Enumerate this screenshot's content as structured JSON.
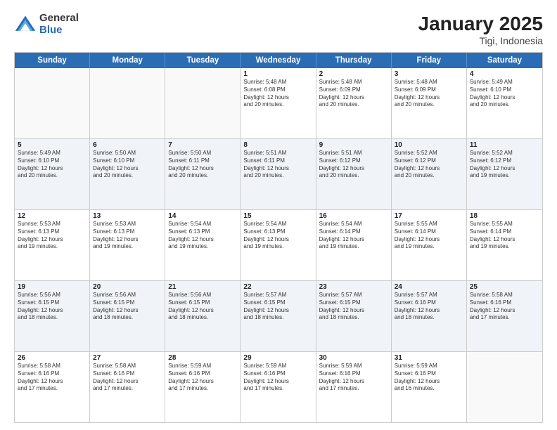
{
  "logo": {
    "general": "General",
    "blue": "Blue"
  },
  "title": {
    "month": "January 2025",
    "location": "Tigi, Indonesia"
  },
  "header_days": [
    "Sunday",
    "Monday",
    "Tuesday",
    "Wednesday",
    "Thursday",
    "Friday",
    "Saturday"
  ],
  "rows": [
    {
      "alt": false,
      "cells": [
        {
          "day": "",
          "text": ""
        },
        {
          "day": "",
          "text": ""
        },
        {
          "day": "",
          "text": ""
        },
        {
          "day": "1",
          "text": "Sunrise: 5:48 AM\nSunset: 6:08 PM\nDaylight: 12 hours\nand 20 minutes."
        },
        {
          "day": "2",
          "text": "Sunrise: 5:48 AM\nSunset: 6:09 PM\nDaylight: 12 hours\nand 20 minutes."
        },
        {
          "day": "3",
          "text": "Sunrise: 5:48 AM\nSunset: 6:09 PM\nDaylight: 12 hours\nand 20 minutes."
        },
        {
          "day": "4",
          "text": "Sunrise: 5:49 AM\nSunset: 6:10 PM\nDaylight: 12 hours\nand 20 minutes."
        }
      ]
    },
    {
      "alt": true,
      "cells": [
        {
          "day": "5",
          "text": "Sunrise: 5:49 AM\nSunset: 6:10 PM\nDaylight: 12 hours\nand 20 minutes."
        },
        {
          "day": "6",
          "text": "Sunrise: 5:50 AM\nSunset: 6:10 PM\nDaylight: 12 hours\nand 20 minutes."
        },
        {
          "day": "7",
          "text": "Sunrise: 5:50 AM\nSunset: 6:11 PM\nDaylight: 12 hours\nand 20 minutes."
        },
        {
          "day": "8",
          "text": "Sunrise: 5:51 AM\nSunset: 6:11 PM\nDaylight: 12 hours\nand 20 minutes."
        },
        {
          "day": "9",
          "text": "Sunrise: 5:51 AM\nSunset: 6:12 PM\nDaylight: 12 hours\nand 20 minutes."
        },
        {
          "day": "10",
          "text": "Sunrise: 5:52 AM\nSunset: 6:12 PM\nDaylight: 12 hours\nand 20 minutes."
        },
        {
          "day": "11",
          "text": "Sunrise: 5:52 AM\nSunset: 6:12 PM\nDaylight: 12 hours\nand 19 minutes."
        }
      ]
    },
    {
      "alt": false,
      "cells": [
        {
          "day": "12",
          "text": "Sunrise: 5:53 AM\nSunset: 6:13 PM\nDaylight: 12 hours\nand 19 minutes."
        },
        {
          "day": "13",
          "text": "Sunrise: 5:53 AM\nSunset: 6:13 PM\nDaylight: 12 hours\nand 19 minutes."
        },
        {
          "day": "14",
          "text": "Sunrise: 5:54 AM\nSunset: 6:13 PM\nDaylight: 12 hours\nand 19 minutes."
        },
        {
          "day": "15",
          "text": "Sunrise: 5:54 AM\nSunset: 6:13 PM\nDaylight: 12 hours\nand 19 minutes."
        },
        {
          "day": "16",
          "text": "Sunrise: 5:54 AM\nSunset: 6:14 PM\nDaylight: 12 hours\nand 19 minutes."
        },
        {
          "day": "17",
          "text": "Sunrise: 5:55 AM\nSunset: 6:14 PM\nDaylight: 12 hours\nand 19 minutes."
        },
        {
          "day": "18",
          "text": "Sunrise: 5:55 AM\nSunset: 6:14 PM\nDaylight: 12 hours\nand 19 minutes."
        }
      ]
    },
    {
      "alt": true,
      "cells": [
        {
          "day": "19",
          "text": "Sunrise: 5:56 AM\nSunset: 6:15 PM\nDaylight: 12 hours\nand 18 minutes."
        },
        {
          "day": "20",
          "text": "Sunrise: 5:56 AM\nSunset: 6:15 PM\nDaylight: 12 hours\nand 18 minutes."
        },
        {
          "day": "21",
          "text": "Sunrise: 5:56 AM\nSunset: 6:15 PM\nDaylight: 12 hours\nand 18 minutes."
        },
        {
          "day": "22",
          "text": "Sunrise: 5:57 AM\nSunset: 6:15 PM\nDaylight: 12 hours\nand 18 minutes."
        },
        {
          "day": "23",
          "text": "Sunrise: 5:57 AM\nSunset: 6:15 PM\nDaylight: 12 hours\nand 18 minutes."
        },
        {
          "day": "24",
          "text": "Sunrise: 5:57 AM\nSunset: 6:16 PM\nDaylight: 12 hours\nand 18 minutes."
        },
        {
          "day": "25",
          "text": "Sunrise: 5:58 AM\nSunset: 6:16 PM\nDaylight: 12 hours\nand 17 minutes."
        }
      ]
    },
    {
      "alt": false,
      "cells": [
        {
          "day": "26",
          "text": "Sunrise: 5:58 AM\nSunset: 6:16 PM\nDaylight: 12 hours\nand 17 minutes."
        },
        {
          "day": "27",
          "text": "Sunrise: 5:58 AM\nSunset: 6:16 PM\nDaylight: 12 hours\nand 17 minutes."
        },
        {
          "day": "28",
          "text": "Sunrise: 5:59 AM\nSunset: 6:16 PM\nDaylight: 12 hours\nand 17 minutes."
        },
        {
          "day": "29",
          "text": "Sunrise: 5:59 AM\nSunset: 6:16 PM\nDaylight: 12 hours\nand 17 minutes."
        },
        {
          "day": "30",
          "text": "Sunrise: 5:59 AM\nSunset: 6:16 PM\nDaylight: 12 hours\nand 17 minutes."
        },
        {
          "day": "31",
          "text": "Sunrise: 5:59 AM\nSunset: 6:16 PM\nDaylight: 12 hours\nand 16 minutes."
        },
        {
          "day": "",
          "text": ""
        }
      ]
    }
  ]
}
